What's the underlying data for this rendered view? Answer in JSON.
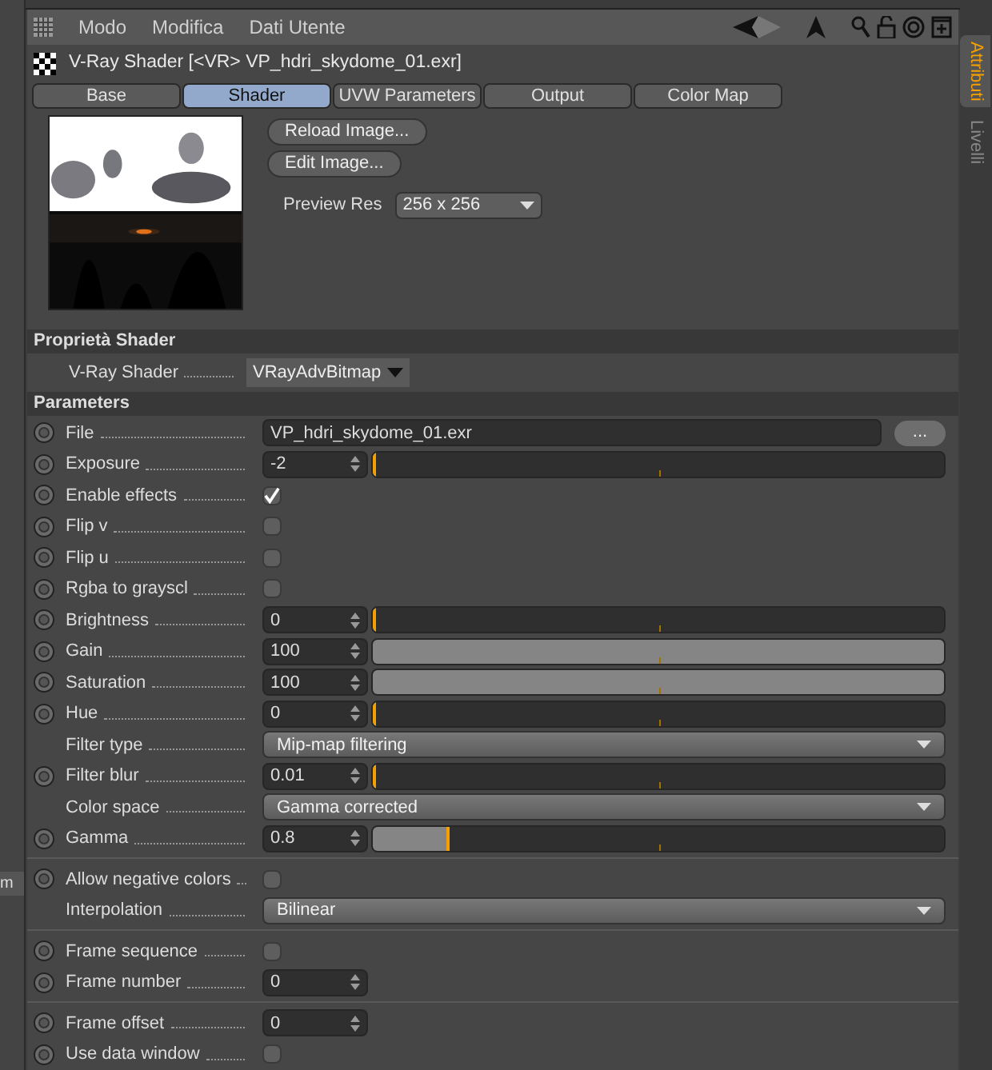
{
  "side_strip": {
    "button_text": "m"
  },
  "menu": [
    "Modo",
    "Modifica",
    "Dati Utente"
  ],
  "title": "V-Ray Shader [<VR> VP_hdri_skydome_01.exr]",
  "tabs": [
    {
      "label": "Base",
      "selected": false
    },
    {
      "label": "Shader",
      "selected": true
    },
    {
      "label": "UVW Parameters",
      "selected": false
    },
    {
      "label": "Output",
      "selected": false
    },
    {
      "label": "Color Map",
      "selected": false
    }
  ],
  "side_tabs": [
    {
      "label": "Attributi",
      "selected": true
    },
    {
      "label": "Livelli",
      "selected": false
    }
  ],
  "preview": {
    "kind": "picture",
    "buttons": [
      "Reload Image...",
      "Edit Image..."
    ],
    "res_label": "Preview Res",
    "res_value": "256 x 256"
  },
  "shader_section": {
    "title": "Proprietà Shader",
    "label": "V-Ray Shader",
    "value": "VRayAdvBitmap"
  },
  "params_title": "Parameters",
  "groups": [
    [
      {
        "kind": "file",
        "label": "File",
        "anim": true,
        "value": "VP_hdri_skydome_01.exr",
        "button": "..."
      },
      {
        "kind": "number",
        "label": "Exposure",
        "anim": true,
        "value": "-2",
        "level": 0
      },
      {
        "kind": "checkbox",
        "label": "Enable effects",
        "anim": true,
        "checked": true
      },
      {
        "kind": "checkbox",
        "label": "Flip v",
        "anim": true,
        "checked": false
      },
      {
        "kind": "checkbox",
        "label": "Flip u",
        "anim": true,
        "checked": false
      },
      {
        "kind": "checkbox",
        "label": "Rgba to grayscl",
        "anim": true,
        "checked": false
      },
      {
        "kind": "number",
        "label": "Brightness",
        "anim": true,
        "value": "0",
        "level": 0
      },
      {
        "kind": "number",
        "label": "Gain",
        "anim": true,
        "value": "100",
        "level": 1
      },
      {
        "kind": "number",
        "label": "Saturation",
        "anim": true,
        "value": "100",
        "level": 1
      },
      {
        "kind": "number",
        "label": "Hue",
        "anim": true,
        "value": "0",
        "level": 0
      },
      {
        "kind": "dropdown",
        "label": "Filter type",
        "anim": false,
        "value": "Mip-map filtering"
      },
      {
        "kind": "number",
        "label": "Filter blur",
        "anim": true,
        "value": "0.01",
        "level": 0
      },
      {
        "kind": "dropdown",
        "label": "Color space",
        "anim": false,
        "value": "Gamma corrected"
      },
      {
        "kind": "number",
        "label": "Gamma",
        "anim": true,
        "value": "0.8",
        "level": 0.13
      }
    ],
    [
      {
        "kind": "checkbox",
        "label": "Allow negative colors",
        "anim": true,
        "checked": false
      },
      {
        "kind": "dropdown",
        "label": "Interpolation",
        "anim": false,
        "value": "Bilinear"
      }
    ],
    [
      {
        "kind": "checkbox",
        "label": "Frame sequence",
        "anim": true,
        "checked": false
      },
      {
        "kind": "spinner",
        "label": "Frame number",
        "anim": true,
        "value": "0"
      }
    ],
    [
      {
        "kind": "spinner",
        "label": "Frame offset",
        "anim": true,
        "value": "0"
      },
      {
        "kind": "checkbox",
        "label": "Use data window",
        "anim": true,
        "checked": false
      }
    ]
  ]
}
